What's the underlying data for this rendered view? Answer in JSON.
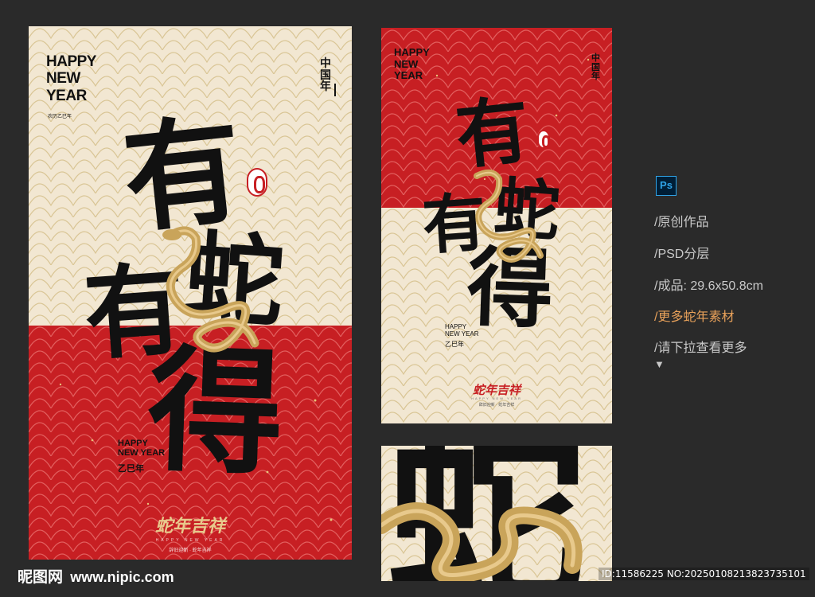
{
  "colors": {
    "background": "#2a2a2a",
    "cream": "#f2e7d2",
    "red": "#c71f23",
    "gold": "#c9a45a",
    "ink": "#111111",
    "accent_orange": "#e8a15a",
    "ps_blue": "#2fa3e6"
  },
  "poster_main": {
    "header": "HAPPY\nNEW\nYEAR",
    "header_sub": "农历乙巳年",
    "seal_top": "中国年",
    "calligraphy": [
      "有",
      "蛇",
      "有",
      "得"
    ],
    "footer_title": "HAPPY\nNEW YEAR",
    "footer_sub": "乙巳年",
    "logo_text": "蛇年吉祥",
    "logo_en": "HAPPY NEW YEAR",
    "logo_sub": "辞旧迎新 · 蛇年吉祥"
  },
  "poster_small": {
    "header": "HAPPY\nNEW\nYEAR",
    "seal_top": "中国年",
    "calligraphy": [
      "有",
      "蛇",
      "有",
      "得"
    ],
    "footer_title": "HAPPY\nNEW YEAR",
    "footer_sub": "乙巳年",
    "logo_text": "蛇年吉祥",
    "logo_en": "HAPPY NEW YEAR",
    "logo_sub": "辞旧迎新 · 蛇年吉祥"
  },
  "detail_crop": {
    "calligraphy": "蛇"
  },
  "sidebar": {
    "ps_icon": "Ps",
    "items": [
      "/原创作品",
      "/PSD分层",
      "/成品: 29.6x50.8cm",
      "/更多蛇年素材",
      "/请下拉查看更多"
    ],
    "arrow": "▼"
  },
  "watermark": {
    "logo": "昵图网",
    "url": "www.nipic.com",
    "id": "ID:11586225 NO:20250108213823735101"
  }
}
